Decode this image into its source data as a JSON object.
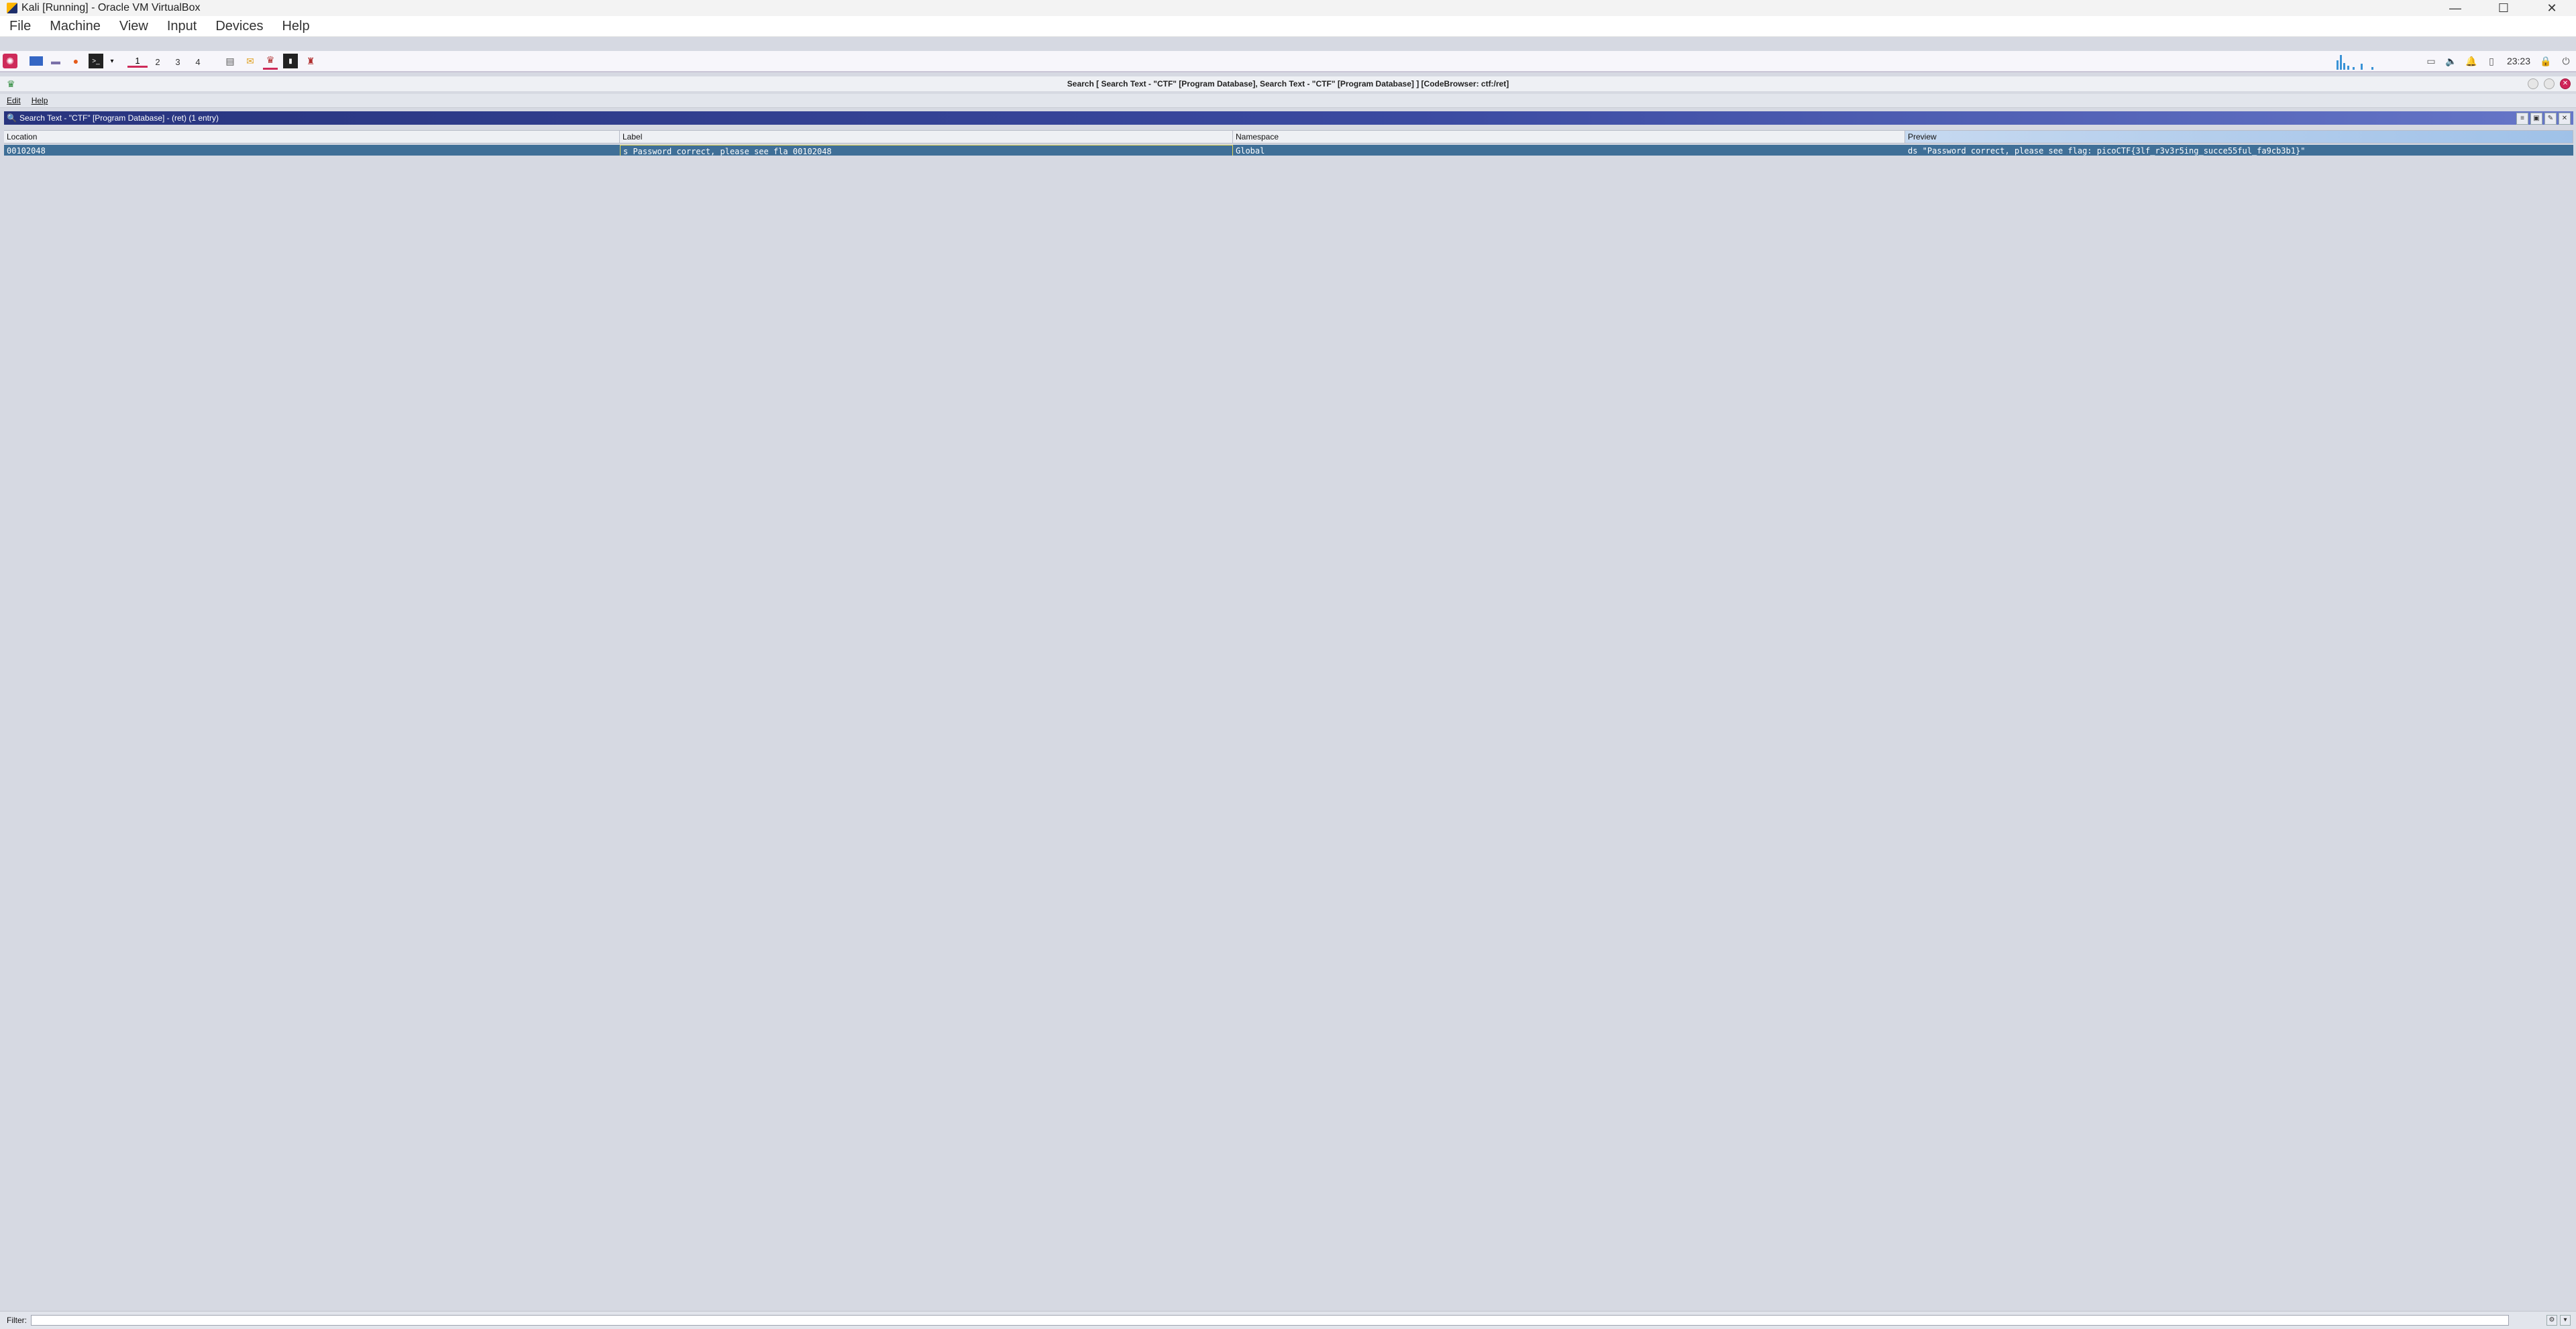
{
  "vbox": {
    "title": "Kali [Running] - Oracle VM VirtualBox",
    "menu": [
      "File",
      "Machine",
      "View",
      "Input",
      "Devices",
      "Help"
    ],
    "controls": {
      "minimize": "—",
      "maximize": "☐",
      "close": "✕"
    }
  },
  "kali_panel": {
    "workspaces": [
      "1",
      "2",
      "3",
      "4"
    ],
    "active_workspace": "1",
    "clock": "23:23"
  },
  "ghidra": {
    "window_title": "Search [ Search Text - \"CTF\"  [Program Database], Search Text - \"CTF\"  [Program Database] ] [CodeBrowser: ctf:/ret]",
    "menu": [
      "Edit",
      "Help"
    ],
    "search_panel": {
      "header": "Search Text - \"CTF\"  [Program Database] - (ret)    (1 entry)",
      "columns": [
        "Location",
        "Label",
        "Namespace",
        "Preview"
      ],
      "rows": [
        {
          "location": "00102048",
          "label": "s_Password_correct,_please_see_fla_00102048",
          "namespace": "Global",
          "preview": "ds \"Password correct, please see flag: picoCTF{3lf_r3v3r5ing_succe55ful_fa9cb3b1}\""
        }
      ]
    },
    "filter": {
      "label": "Filter:",
      "value": ""
    }
  },
  "colors": {
    "selection_row": "#3f6f97",
    "header_gradient_start": "#28347e",
    "kali_accent": "#ce2b5a"
  }
}
